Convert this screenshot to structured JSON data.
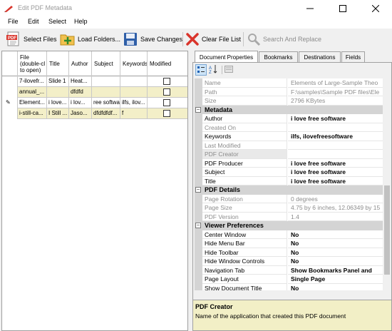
{
  "window": {
    "title": "Edit PDF Metadata",
    "brand_color": "#d9342b"
  },
  "menu": [
    "File",
    "Edit",
    "Select",
    "Help"
  ],
  "toolbar": {
    "select_files": "Select Files",
    "load_folders": "Load Folders...",
    "save_changes": "Save Changes",
    "clear_list": "Clear File List",
    "search_replace": "Search And Replace"
  },
  "grid": {
    "headers": [
      "File\n(double-cl\nto open)",
      "Title",
      "Author",
      "Subject",
      "Keywords",
      "Modified"
    ],
    "rows": [
      {
        "file": "7-ilovefr...",
        "title": "Slide 1",
        "author": "Heat...",
        "subject": "",
        "keywords": "",
        "modified": false,
        "highlight": false,
        "edit_marker": ""
      },
      {
        "file": "annual_...",
        "title": "",
        "author": "dfdfd",
        "subject": "",
        "keywords": "",
        "modified": false,
        "highlight": true,
        "edit_marker": ""
      },
      {
        "file": "Element...",
        "title": "i love...",
        "author": "i lov...",
        "subject": "ree softwa",
        "keywords": "ilfs, ilov...",
        "modified": false,
        "highlight": false,
        "edit_marker": "✎"
      },
      {
        "file": "i-still-ca...",
        "title": "I Still ...",
        "author": "Jaso...",
        "subject": "dfdfdfdf...",
        "keywords": "f",
        "modified": false,
        "highlight": true,
        "edit_marker": ""
      }
    ]
  },
  "tabs": [
    "Document Properties",
    "Bookmarks",
    "Destinations",
    "Fields"
  ],
  "properties": [
    {
      "kind": "row",
      "name": "Name",
      "value": "Elements of Large-Sample Theo",
      "ro": true
    },
    {
      "kind": "row",
      "name": "Path",
      "value": "F:\\samples\\Sample PDF files\\Ele",
      "ro": true
    },
    {
      "kind": "row",
      "name": "Size",
      "value": "2796 KBytes",
      "ro": true
    },
    {
      "kind": "cat",
      "name": "Metadata"
    },
    {
      "kind": "row",
      "name": "Author",
      "value": "i love free software",
      "ro": false
    },
    {
      "kind": "row",
      "name": "Created On",
      "value": "",
      "ro": true
    },
    {
      "kind": "row",
      "name": "Keywords",
      "value": "ilfs, ilovefreesoftware",
      "ro": false
    },
    {
      "kind": "row",
      "name": "Last Modified",
      "value": "",
      "ro": true
    },
    {
      "kind": "row",
      "name": "PDF Creator",
      "value": "",
      "ro": true,
      "selected": true
    },
    {
      "kind": "row",
      "name": "PDF Producer",
      "value": "i love free software",
      "ro": false
    },
    {
      "kind": "row",
      "name": "Subject",
      "value": "i love free software",
      "ro": false
    },
    {
      "kind": "row",
      "name": "Title",
      "value": "i love free software",
      "ro": false
    },
    {
      "kind": "cat",
      "name": "PDF Details"
    },
    {
      "kind": "row",
      "name": "Page Rotation",
      "value": "0 degrees",
      "ro": true
    },
    {
      "kind": "row",
      "name": "Page Size",
      "value": "4.75 by 6 inches, 12.06349 by 15",
      "ro": true
    },
    {
      "kind": "row",
      "name": "PDF Version",
      "value": "1.4",
      "ro": true
    },
    {
      "kind": "cat",
      "name": "Viewer Preferences"
    },
    {
      "kind": "row",
      "name": "Center Window",
      "value": "No",
      "ro": false
    },
    {
      "kind": "row",
      "name": "Hide Menu Bar",
      "value": "No",
      "ro": false
    },
    {
      "kind": "row",
      "name": "Hide Toolbar",
      "value": "No",
      "ro": false
    },
    {
      "kind": "row",
      "name": "Hide Window Controls",
      "value": "No",
      "ro": false
    },
    {
      "kind": "row",
      "name": "Navigation Tab",
      "value": "Show Bookmarks Panel and",
      "ro": false
    },
    {
      "kind": "row",
      "name": "Page Layout",
      "value": "Single Page",
      "ro": false
    },
    {
      "kind": "row",
      "name": "Show Document Title",
      "value": "No",
      "ro": false
    }
  ],
  "help": {
    "title": "PDF Creator",
    "description": "Name of the application that created this PDF document"
  }
}
